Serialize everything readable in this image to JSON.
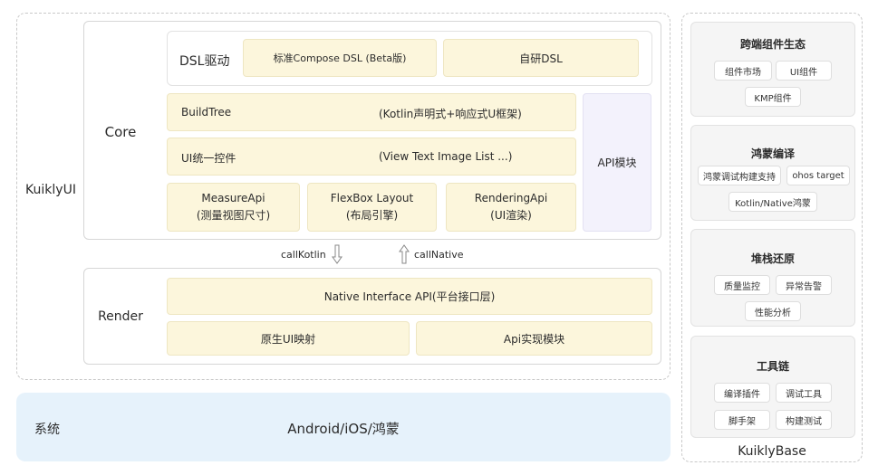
{
  "kuikly_ui": {
    "label": "KuiklyUI",
    "core": {
      "label": "Core",
      "dsl": {
        "label": "DSL驱动",
        "items": [
          "标准Compose DSL (Beta版)",
          "自研DSL"
        ]
      },
      "build_tree": {
        "label": "BuildTree",
        "desc": "(Kotlin声明式+响应式U框架)"
      },
      "ui_controls": {
        "label": "UI统一控件",
        "desc": "(View Text Image List ...)"
      },
      "apis": [
        {
          "name": "MeasureApi",
          "desc": "(测量视图尺寸)"
        },
        {
          "name": "FlexBox Layout",
          "desc": "(布局引擎)"
        },
        {
          "name": "RenderingApi",
          "desc": "(UI渲染)"
        }
      ],
      "api_module": "API模块"
    },
    "calls": {
      "call_kotlin": "callKotlin",
      "call_native": "callNative"
    },
    "render": {
      "label": "Render",
      "native_interface": "Native Interface API(平台接口层)",
      "native_ui_mapping": "原生UI映射",
      "api_impl": "Api实现模块"
    }
  },
  "system": {
    "label": "系统",
    "platforms": "Android/iOS/鸿蒙"
  },
  "kuikly_base": {
    "label": "KuiklyBase",
    "cards": [
      {
        "title": "跨端组件生态",
        "chips": [
          "组件市场",
          "UI组件",
          "KMP组件"
        ]
      },
      {
        "title": "鸿蒙编译",
        "chips": [
          "鸿蒙调试构建支持",
          "ohos target",
          "Kotlin/Native鸿蒙"
        ]
      },
      {
        "title": "堆栈还原",
        "chips": [
          "质量监控",
          "异常告警",
          "性能分析"
        ]
      },
      {
        "title": "工具链",
        "chips": [
          "编译插件",
          "调试工具",
          "脚手架",
          "构建测试"
        ]
      }
    ]
  },
  "colors": {
    "yellow_fill": "#fcf6dc",
    "lavender_fill": "#f3f2fc",
    "system_fill": "#e6f2fb",
    "card_fill": "#f5f5f5",
    "dashed_border": "#c8c8c8"
  }
}
